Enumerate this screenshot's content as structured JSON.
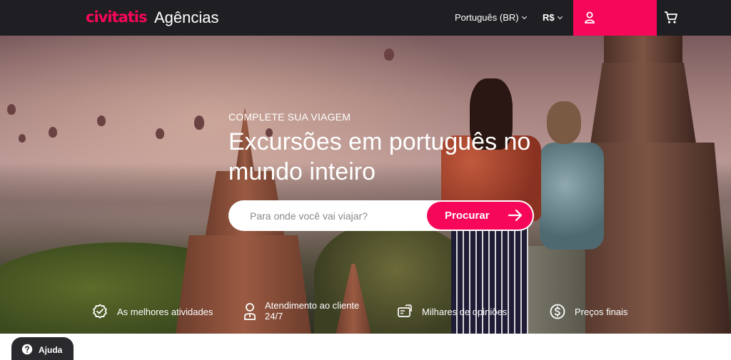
{
  "header": {
    "logo": "civitatis",
    "brand_subtitle": "Agências",
    "language": "Português (BR)",
    "currency": "R$",
    "user_icon": "user-icon",
    "cart_icon": "cart-icon"
  },
  "hero": {
    "tagline": "COMPLETE SUA VIAGEM",
    "headline": "Excursões em português no mundo inteiro",
    "search": {
      "placeholder": "Para onde você vai viajar?",
      "button_label": "Procurar",
      "button_icon": "arrow-right-icon"
    }
  },
  "features": [
    {
      "icon": "check-badge-icon",
      "label": "As melhores atividades"
    },
    {
      "icon": "headset-icon",
      "label": "Atendimento ao cliente 24/7"
    },
    {
      "icon": "reviews-icon",
      "label": "Milhares de opiniões"
    },
    {
      "icon": "dollar-icon",
      "label": "Preços finais"
    }
  ],
  "help": {
    "label": "Ajuda",
    "icon": "question-icon"
  },
  "colors": {
    "brand": "#f70759",
    "topbar": "#1f1e23"
  }
}
